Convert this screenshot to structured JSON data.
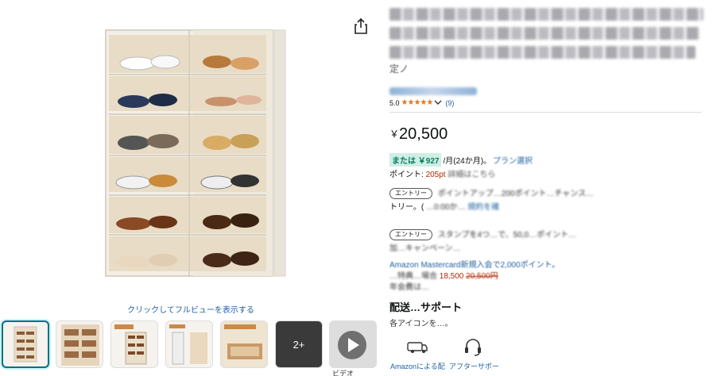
{
  "image": {
    "fullview_link": "クリックしてフルビューを表示する",
    "thumbs_more_label": "2+",
    "video_label": "ビデオ"
  },
  "title": {
    "visible_tail": "定ノ"
  },
  "rating": {
    "value": "5.0",
    "stars": "★★★★★",
    "count": "(9)"
  },
  "price": {
    "currency": "￥",
    "amount": "20,500"
  },
  "installment": {
    "badge": "または ￥927",
    "text": "/月(24か月)。",
    "link_fragment": "プラン選択"
  },
  "points": {
    "label": "ポイント:",
    "value": "205pt",
    "detail_fragment": "詳細はこちら"
  },
  "promos": [
    {
      "badge": "エントリー",
      "line1": "ポイントアップ…200ポイント…チャンス…",
      "line2_prefix": "トリー。(",
      "line2_mid": "…0:00か…",
      "line2_link": "規約を確"
    },
    {
      "badge": "エントリー",
      "line1": "スタンプを4つ…で、50,0…ポイント…",
      "line2": "加…キャンペーン…"
    }
  ],
  "mastercard": {
    "line1_link": "Amazon Mastercard新規入会で2,000ポイント。",
    "line2_prefix": "…特典…場合",
    "line2_price_new": "18,500",
    "line2_price_old": "20,500円",
    "line3": "年会費は…"
  },
  "delivery": {
    "heading": "配送…サポート",
    "sub": "各アイコンを…。",
    "icons": [
      {
        "name": "delivery-van-icon",
        "label": "Amazonによる配"
      },
      {
        "name": "support-headset-icon",
        "label": "アフターサポー"
      }
    ]
  },
  "colors": {
    "link": "#2162a1",
    "price_red": "#b12704",
    "star": "#de7921",
    "badge_green_bg": "#cfeee4",
    "badge_green_text": "#067d62"
  }
}
